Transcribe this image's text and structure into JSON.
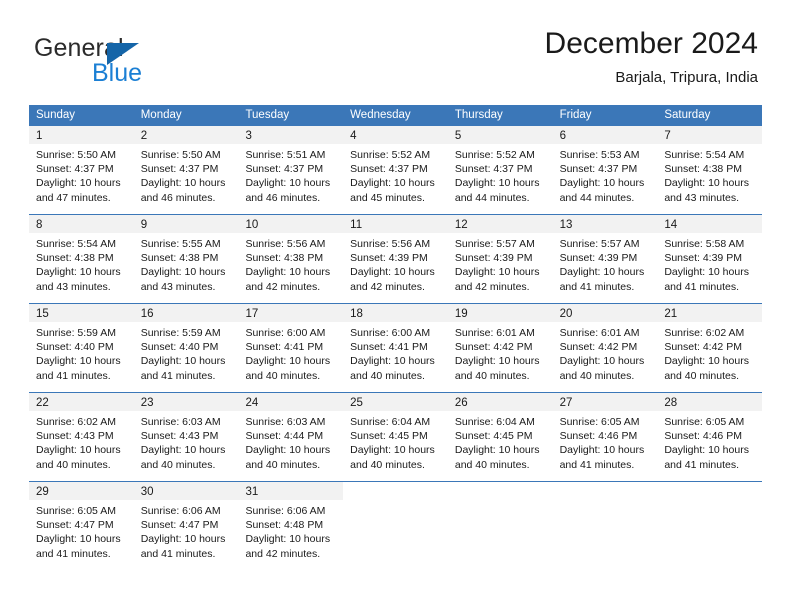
{
  "logo": {
    "primary_text": "General",
    "secondary_text": "Blue",
    "primary_color": "#2b2b2b",
    "secondary_color": "#1b7fd4",
    "triangle_color": "#1565a8"
  },
  "header": {
    "title": "December 2024",
    "subtitle": "Barjala, Tripura, India"
  },
  "theme": {
    "header_row_bg": "#3b77b8",
    "header_row_text": "#ffffff",
    "day_band_bg": "#f2f2f2",
    "row_divider": "#3b77b8",
    "body_text": "#1a1a1a"
  },
  "weekdays": [
    "Sunday",
    "Monday",
    "Tuesday",
    "Wednesday",
    "Thursday",
    "Friday",
    "Saturday"
  ],
  "weeks": [
    [
      {
        "day": "1",
        "sunrise": "Sunrise: 5:50 AM",
        "sunset": "Sunset: 4:37 PM",
        "daylight_1": "Daylight: 10 hours",
        "daylight_2": "and 47 minutes."
      },
      {
        "day": "2",
        "sunrise": "Sunrise: 5:50 AM",
        "sunset": "Sunset: 4:37 PM",
        "daylight_1": "Daylight: 10 hours",
        "daylight_2": "and 46 minutes."
      },
      {
        "day": "3",
        "sunrise": "Sunrise: 5:51 AM",
        "sunset": "Sunset: 4:37 PM",
        "daylight_1": "Daylight: 10 hours",
        "daylight_2": "and 46 minutes."
      },
      {
        "day": "4",
        "sunrise": "Sunrise: 5:52 AM",
        "sunset": "Sunset: 4:37 PM",
        "daylight_1": "Daylight: 10 hours",
        "daylight_2": "and 45 minutes."
      },
      {
        "day": "5",
        "sunrise": "Sunrise: 5:52 AM",
        "sunset": "Sunset: 4:37 PM",
        "daylight_1": "Daylight: 10 hours",
        "daylight_2": "and 44 minutes."
      },
      {
        "day": "6",
        "sunrise": "Sunrise: 5:53 AM",
        "sunset": "Sunset: 4:37 PM",
        "daylight_1": "Daylight: 10 hours",
        "daylight_2": "and 44 minutes."
      },
      {
        "day": "7",
        "sunrise": "Sunrise: 5:54 AM",
        "sunset": "Sunset: 4:38 PM",
        "daylight_1": "Daylight: 10 hours",
        "daylight_2": "and 43 minutes."
      }
    ],
    [
      {
        "day": "8",
        "sunrise": "Sunrise: 5:54 AM",
        "sunset": "Sunset: 4:38 PM",
        "daylight_1": "Daylight: 10 hours",
        "daylight_2": "and 43 minutes."
      },
      {
        "day": "9",
        "sunrise": "Sunrise: 5:55 AM",
        "sunset": "Sunset: 4:38 PM",
        "daylight_1": "Daylight: 10 hours",
        "daylight_2": "and 43 minutes."
      },
      {
        "day": "10",
        "sunrise": "Sunrise: 5:56 AM",
        "sunset": "Sunset: 4:38 PM",
        "daylight_1": "Daylight: 10 hours",
        "daylight_2": "and 42 minutes."
      },
      {
        "day": "11",
        "sunrise": "Sunrise: 5:56 AM",
        "sunset": "Sunset: 4:39 PM",
        "daylight_1": "Daylight: 10 hours",
        "daylight_2": "and 42 minutes."
      },
      {
        "day": "12",
        "sunrise": "Sunrise: 5:57 AM",
        "sunset": "Sunset: 4:39 PM",
        "daylight_1": "Daylight: 10 hours",
        "daylight_2": "and 42 minutes."
      },
      {
        "day": "13",
        "sunrise": "Sunrise: 5:57 AM",
        "sunset": "Sunset: 4:39 PM",
        "daylight_1": "Daylight: 10 hours",
        "daylight_2": "and 41 minutes."
      },
      {
        "day": "14",
        "sunrise": "Sunrise: 5:58 AM",
        "sunset": "Sunset: 4:39 PM",
        "daylight_1": "Daylight: 10 hours",
        "daylight_2": "and 41 minutes."
      }
    ],
    [
      {
        "day": "15",
        "sunrise": "Sunrise: 5:59 AM",
        "sunset": "Sunset: 4:40 PM",
        "daylight_1": "Daylight: 10 hours",
        "daylight_2": "and 41 minutes."
      },
      {
        "day": "16",
        "sunrise": "Sunrise: 5:59 AM",
        "sunset": "Sunset: 4:40 PM",
        "daylight_1": "Daylight: 10 hours",
        "daylight_2": "and 41 minutes."
      },
      {
        "day": "17",
        "sunrise": "Sunrise: 6:00 AM",
        "sunset": "Sunset: 4:41 PM",
        "daylight_1": "Daylight: 10 hours",
        "daylight_2": "and 40 minutes."
      },
      {
        "day": "18",
        "sunrise": "Sunrise: 6:00 AM",
        "sunset": "Sunset: 4:41 PM",
        "daylight_1": "Daylight: 10 hours",
        "daylight_2": "and 40 minutes."
      },
      {
        "day": "19",
        "sunrise": "Sunrise: 6:01 AM",
        "sunset": "Sunset: 4:42 PM",
        "daylight_1": "Daylight: 10 hours",
        "daylight_2": "and 40 minutes."
      },
      {
        "day": "20",
        "sunrise": "Sunrise: 6:01 AM",
        "sunset": "Sunset: 4:42 PM",
        "daylight_1": "Daylight: 10 hours",
        "daylight_2": "and 40 minutes."
      },
      {
        "day": "21",
        "sunrise": "Sunrise: 6:02 AM",
        "sunset": "Sunset: 4:42 PM",
        "daylight_1": "Daylight: 10 hours",
        "daylight_2": "and 40 minutes."
      }
    ],
    [
      {
        "day": "22",
        "sunrise": "Sunrise: 6:02 AM",
        "sunset": "Sunset: 4:43 PM",
        "daylight_1": "Daylight: 10 hours",
        "daylight_2": "and 40 minutes."
      },
      {
        "day": "23",
        "sunrise": "Sunrise: 6:03 AM",
        "sunset": "Sunset: 4:43 PM",
        "daylight_1": "Daylight: 10 hours",
        "daylight_2": "and 40 minutes."
      },
      {
        "day": "24",
        "sunrise": "Sunrise: 6:03 AM",
        "sunset": "Sunset: 4:44 PM",
        "daylight_1": "Daylight: 10 hours",
        "daylight_2": "and 40 minutes."
      },
      {
        "day": "25",
        "sunrise": "Sunrise: 6:04 AM",
        "sunset": "Sunset: 4:45 PM",
        "daylight_1": "Daylight: 10 hours",
        "daylight_2": "and 40 minutes."
      },
      {
        "day": "26",
        "sunrise": "Sunrise: 6:04 AM",
        "sunset": "Sunset: 4:45 PM",
        "daylight_1": "Daylight: 10 hours",
        "daylight_2": "and 40 minutes."
      },
      {
        "day": "27",
        "sunrise": "Sunrise: 6:05 AM",
        "sunset": "Sunset: 4:46 PM",
        "daylight_1": "Daylight: 10 hours",
        "daylight_2": "and 41 minutes."
      },
      {
        "day": "28",
        "sunrise": "Sunrise: 6:05 AM",
        "sunset": "Sunset: 4:46 PM",
        "daylight_1": "Daylight: 10 hours",
        "daylight_2": "and 41 minutes."
      }
    ],
    [
      {
        "day": "29",
        "sunrise": "Sunrise: 6:05 AM",
        "sunset": "Sunset: 4:47 PM",
        "daylight_1": "Daylight: 10 hours",
        "daylight_2": "and 41 minutes."
      },
      {
        "day": "30",
        "sunrise": "Sunrise: 6:06 AM",
        "sunset": "Sunset: 4:47 PM",
        "daylight_1": "Daylight: 10 hours",
        "daylight_2": "and 41 minutes."
      },
      {
        "day": "31",
        "sunrise": "Sunrise: 6:06 AM",
        "sunset": "Sunset: 4:48 PM",
        "daylight_1": "Daylight: 10 hours",
        "daylight_2": "and 42 minutes."
      },
      {
        "day": "",
        "sunrise": "",
        "sunset": "",
        "daylight_1": "",
        "daylight_2": ""
      },
      {
        "day": "",
        "sunrise": "",
        "sunset": "",
        "daylight_1": "",
        "daylight_2": ""
      },
      {
        "day": "",
        "sunrise": "",
        "sunset": "",
        "daylight_1": "",
        "daylight_2": ""
      },
      {
        "day": "",
        "sunrise": "",
        "sunset": "",
        "daylight_1": "",
        "daylight_2": ""
      }
    ]
  ]
}
